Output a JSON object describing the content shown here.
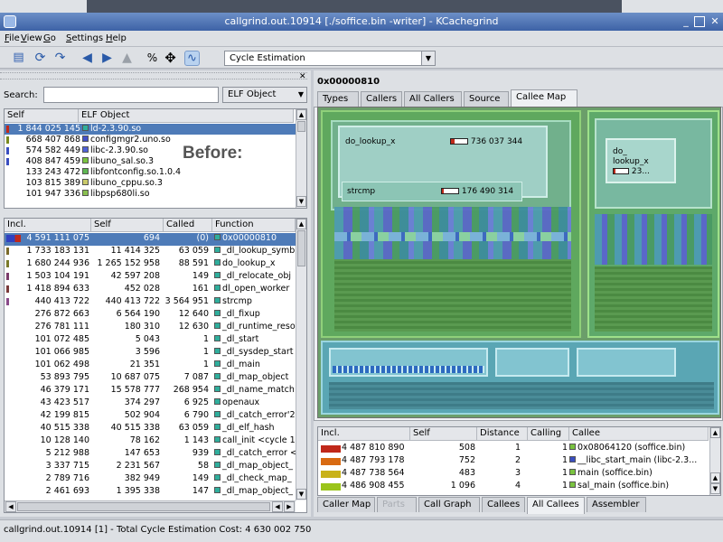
{
  "window": {
    "title": "callgrind.out.10914 [./soffice.bin -writer] - KCachegrind"
  },
  "menu": {
    "items": [
      {
        "label": "File",
        "u": "F"
      },
      {
        "label": "View",
        "u": "V"
      },
      {
        "label": "Go",
        "u": "G"
      },
      {
        "label": "Settings",
        "u": "S"
      },
      {
        "label": "Help",
        "u": "H"
      }
    ]
  },
  "toolbar": {
    "percent_label": "%",
    "cost_type": "Cycle Estimation"
  },
  "search": {
    "label": "Search:",
    "value": "",
    "group_type": "ELF Object"
  },
  "annotation": "Before:",
  "elf_table": {
    "headers": [
      "Self",
      "ELF Object"
    ],
    "rows": [
      {
        "self": "1 844 025 145",
        "name": "ld-2.3.90.so",
        "color": "#2fae9c",
        "selected": true,
        "bar": "#c0281a"
      },
      {
        "self": "668 407 868",
        "name": "configmgr2.uno.so",
        "color": "#4450c8",
        "bar": "#7a8a1e"
      },
      {
        "self": "574 582 449",
        "name": "libc-2.3.90.so",
        "color": "#5062d8",
        "bar": "#3a4ec0"
      },
      {
        "self": "408 847 459",
        "name": "libuno_sal.so.3",
        "color": "#7ac340",
        "bar": "#3a4ec0"
      },
      {
        "self": "133 243 472",
        "name": "libfontconfig.so.1.0.4",
        "color": "#5fb852",
        "bar": ""
      },
      {
        "self": "103 815 389",
        "name": "libuno_cppu.so.3",
        "color": "#c9c96a",
        "bar": ""
      },
      {
        "self": "101 947 336",
        "name": "libpsp680li.so",
        "color": "#8ac050",
        "bar": ""
      }
    ]
  },
  "func_table": {
    "headers": [
      "Incl.",
      "Self",
      "Called",
      "Function"
    ],
    "rows": [
      {
        "incl": "4 591 111 075",
        "self": "694",
        "called": "(0)",
        "name": "0x00000810",
        "color": "#2fae9c",
        "selected": true
      },
      {
        "incl": "1 733 183 131",
        "self": "11 414 325",
        "called": "63 059",
        "name": "_dl_lookup_symb",
        "color": "#2fae9c"
      },
      {
        "incl": "1 680 244 936",
        "self": "1 265 152 958",
        "called": "88 591",
        "name": "do_lookup_x",
        "color": "#2fae9c"
      },
      {
        "incl": "1 503 104 191",
        "self": "42 597 208",
        "called": "149",
        "name": "_dl_relocate_obj",
        "color": "#2fae9c"
      },
      {
        "incl": "1 418 894 633",
        "self": "452 028",
        "called": "161",
        "name": "dl_open_worker",
        "color": "#2fae9c"
      },
      {
        "incl": "440 413 722",
        "self": "440 413 722",
        "called": "3 564 951",
        "name": "strcmp",
        "color": "#2fae9c"
      },
      {
        "incl": "276 872 663",
        "self": "6 564 190",
        "called": "12 640",
        "name": "_dl_fixup",
        "color": "#2fae9c"
      },
      {
        "incl": "276 781 111",
        "self": "180 310",
        "called": "12 630",
        "name": "_dl_runtime_reso",
        "color": "#2fae9c"
      },
      {
        "incl": "101 072 485",
        "self": "5 043",
        "called": "1",
        "name": "_dl_start",
        "color": "#2fae9c"
      },
      {
        "incl": "101 066 985",
        "self": "3 596",
        "called": "1",
        "name": "_dl_sysdep_start",
        "color": "#2fae9c"
      },
      {
        "incl": "101 062 498",
        "self": "21 351",
        "called": "1",
        "name": "_dl_main",
        "color": "#2fae9c"
      },
      {
        "incl": "53 893 795",
        "self": "10 687 075",
        "called": "7 087",
        "name": "_dl_map_object",
        "color": "#2fae9c"
      },
      {
        "incl": "46 379 171",
        "self": "15 578 777",
        "called": "268 954",
        "name": "_dl_name_match",
        "color": "#2fae9c"
      },
      {
        "incl": "43 423 517",
        "self": "374 297",
        "called": "6 925",
        "name": "openaux",
        "color": "#2fae9c"
      },
      {
        "incl": "42 199 815",
        "self": "502 904",
        "called": "6 790",
        "name": "_dl_catch_error'2",
        "color": "#2fae9c"
      },
      {
        "incl": "40 515 338",
        "self": "40 515 338",
        "called": "63 059",
        "name": "_dl_elf_hash",
        "color": "#2fae9c"
      },
      {
        "incl": "10 128 140",
        "self": "78 162",
        "called": "1 143",
        "name": "call_init <cycle 1",
        "color": "#2fae9c"
      },
      {
        "incl": "5 212 988",
        "self": "147 653",
        "called": "939",
        "name": "_dl_catch_error <",
        "color": "#2fae9c"
      },
      {
        "incl": "3 337 715",
        "self": "2 231 567",
        "called": "58",
        "name": "_dl_map_object_",
        "color": "#2fae9c"
      },
      {
        "incl": "2 789 716",
        "self": "382 949",
        "called": "149",
        "name": "_dl_check_map_",
        "color": "#2fae9c"
      },
      {
        "incl": "2 461 693",
        "self": "1 395 338",
        "called": "147",
        "name": "_dl_map_object_",
        "color": "#2fae9c"
      }
    ]
  },
  "right": {
    "function_title": "0x00000810",
    "tabs": [
      "Types",
      "Callers",
      "All Callers",
      "Source",
      "Callee Map"
    ],
    "active_tab": "Callee Map",
    "treemap": {
      "do_lookup": {
        "name": "do_lookup_x",
        "value": "736 037 344"
      },
      "strcmp": {
        "name": "strcmp",
        "value": "176 490 314"
      },
      "do_small": {
        "line1": "do_",
        "line2": "lookup_x",
        "value": "23..."
      }
    }
  },
  "callee_table": {
    "headers": [
      "Incl.",
      "Self",
      "Distance",
      "Calling",
      "Callee"
    ],
    "rows": [
      {
        "incl": "4 487 810 890",
        "self": "508",
        "distance": "1",
        "calling": "1",
        "callee": "0x08064120 (soffice.bin)",
        "bar": "#c0281a",
        "color": "#7ac340"
      },
      {
        "incl": "4 487 793 178",
        "self": "752",
        "distance": "2",
        "calling": "1",
        "callee": "__libc_start_main (libc-2.3...",
        "bar": "#d86a12",
        "color": "#3a4ec0"
      },
      {
        "incl": "4 487 738 564",
        "self": "483",
        "distance": "3",
        "calling": "1",
        "callee": "main (soffice.bin)",
        "bar": "#c9b21a",
        "color": "#7ac340"
      },
      {
        "incl": "4 486 908 455",
        "self": "1 096",
        "distance": "4",
        "calling": "1",
        "callee": "sal_main (soffice.bin)",
        "bar": "#9ac41a",
        "color": "#7ac340"
      }
    ]
  },
  "bottom_tabs": [
    "Caller Map",
    "Parts",
    "Call Graph",
    "Callees",
    "All Callees",
    "Assembler"
  ],
  "bottom_active": "All Callees",
  "status": "callgrind.out.10914 [1] - Total Cycle Estimation Cost:  4 630 002 750"
}
